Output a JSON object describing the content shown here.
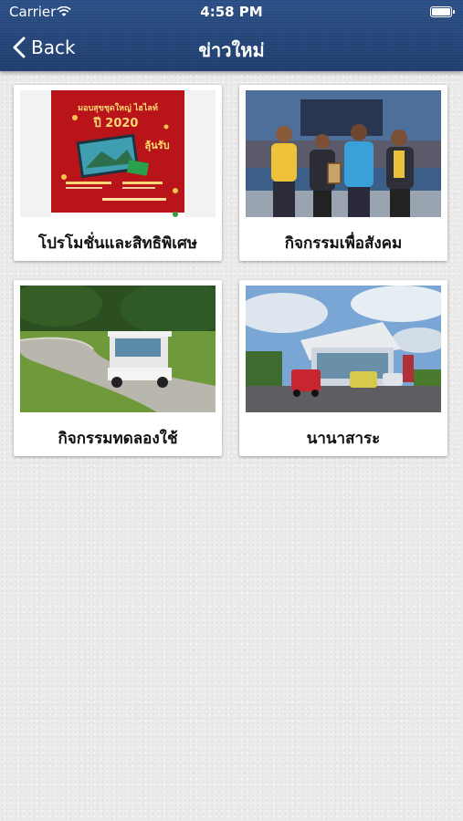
{
  "status_bar": {
    "carrier": "Carrier",
    "time": "4:58 PM"
  },
  "nav": {
    "back_label": "Back",
    "title": "ข่าวใหม่"
  },
  "cards": [
    {
      "label": "โปรโมชั่นและสิทธิพิเศษ",
      "image_text": [
        "มอบสุขชุดใหญ่ ไฮไลท์",
        "ปี 2020",
        "ลุ้นรับ"
      ]
    },
    {
      "label": "กิจกรรมเพื่อสังคม"
    },
    {
      "label": "กิจกรรมทดลองใช้"
    },
    {
      "label": "นานาสาระ"
    }
  ]
}
